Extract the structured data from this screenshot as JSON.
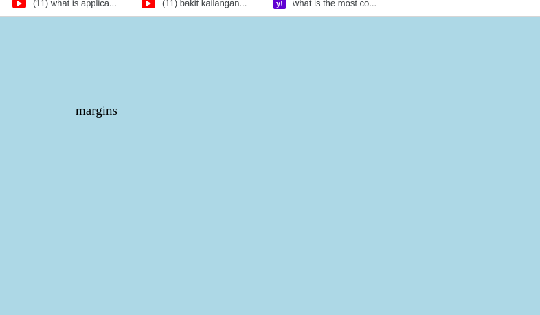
{
  "bookmarks": [
    {
      "label": "(11) what is applica...",
      "icon": "youtube-icon"
    },
    {
      "label": "(11) bakit kailangan...",
      "icon": "youtube-icon"
    },
    {
      "label": "what is the most co...",
      "icon": "yahoo-icon"
    }
  ],
  "page": {
    "text": "margins",
    "background_color": "#add8e6"
  }
}
